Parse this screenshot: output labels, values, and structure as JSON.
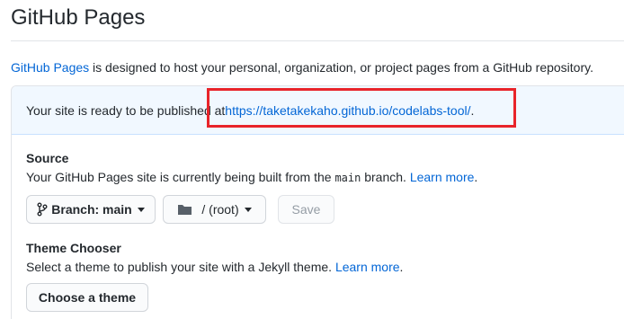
{
  "page_title": "GitHub Pages",
  "description": {
    "link": "GitHub Pages",
    "text": " is designed to host your personal, organization, or project pages from a GitHub repository."
  },
  "flash": {
    "text": "Your site is ready to be published at ",
    "url": "https://taketakekaho.github.io/codelabs-tool/",
    "suffix": "."
  },
  "source": {
    "heading": "Source",
    "note_pre": "Your GitHub Pages site is currently being built from the ",
    "branch_code": "main",
    "note_post": " branch. ",
    "learn_more": "Learn more",
    "note_end": ".",
    "branch_button": "Branch: main",
    "folder_button": "/ (root)",
    "save_button": "Save"
  },
  "theme": {
    "heading": "Theme Chooser",
    "note": "Select a theme to publish your site with a Jekyll theme. ",
    "learn_more": "Learn more",
    "note_end": ".",
    "choose_button": "Choose a theme"
  },
  "colors": {
    "link": "#0366d6",
    "highlight": "#e8242a",
    "flash_bg": "#f1f8ff"
  }
}
